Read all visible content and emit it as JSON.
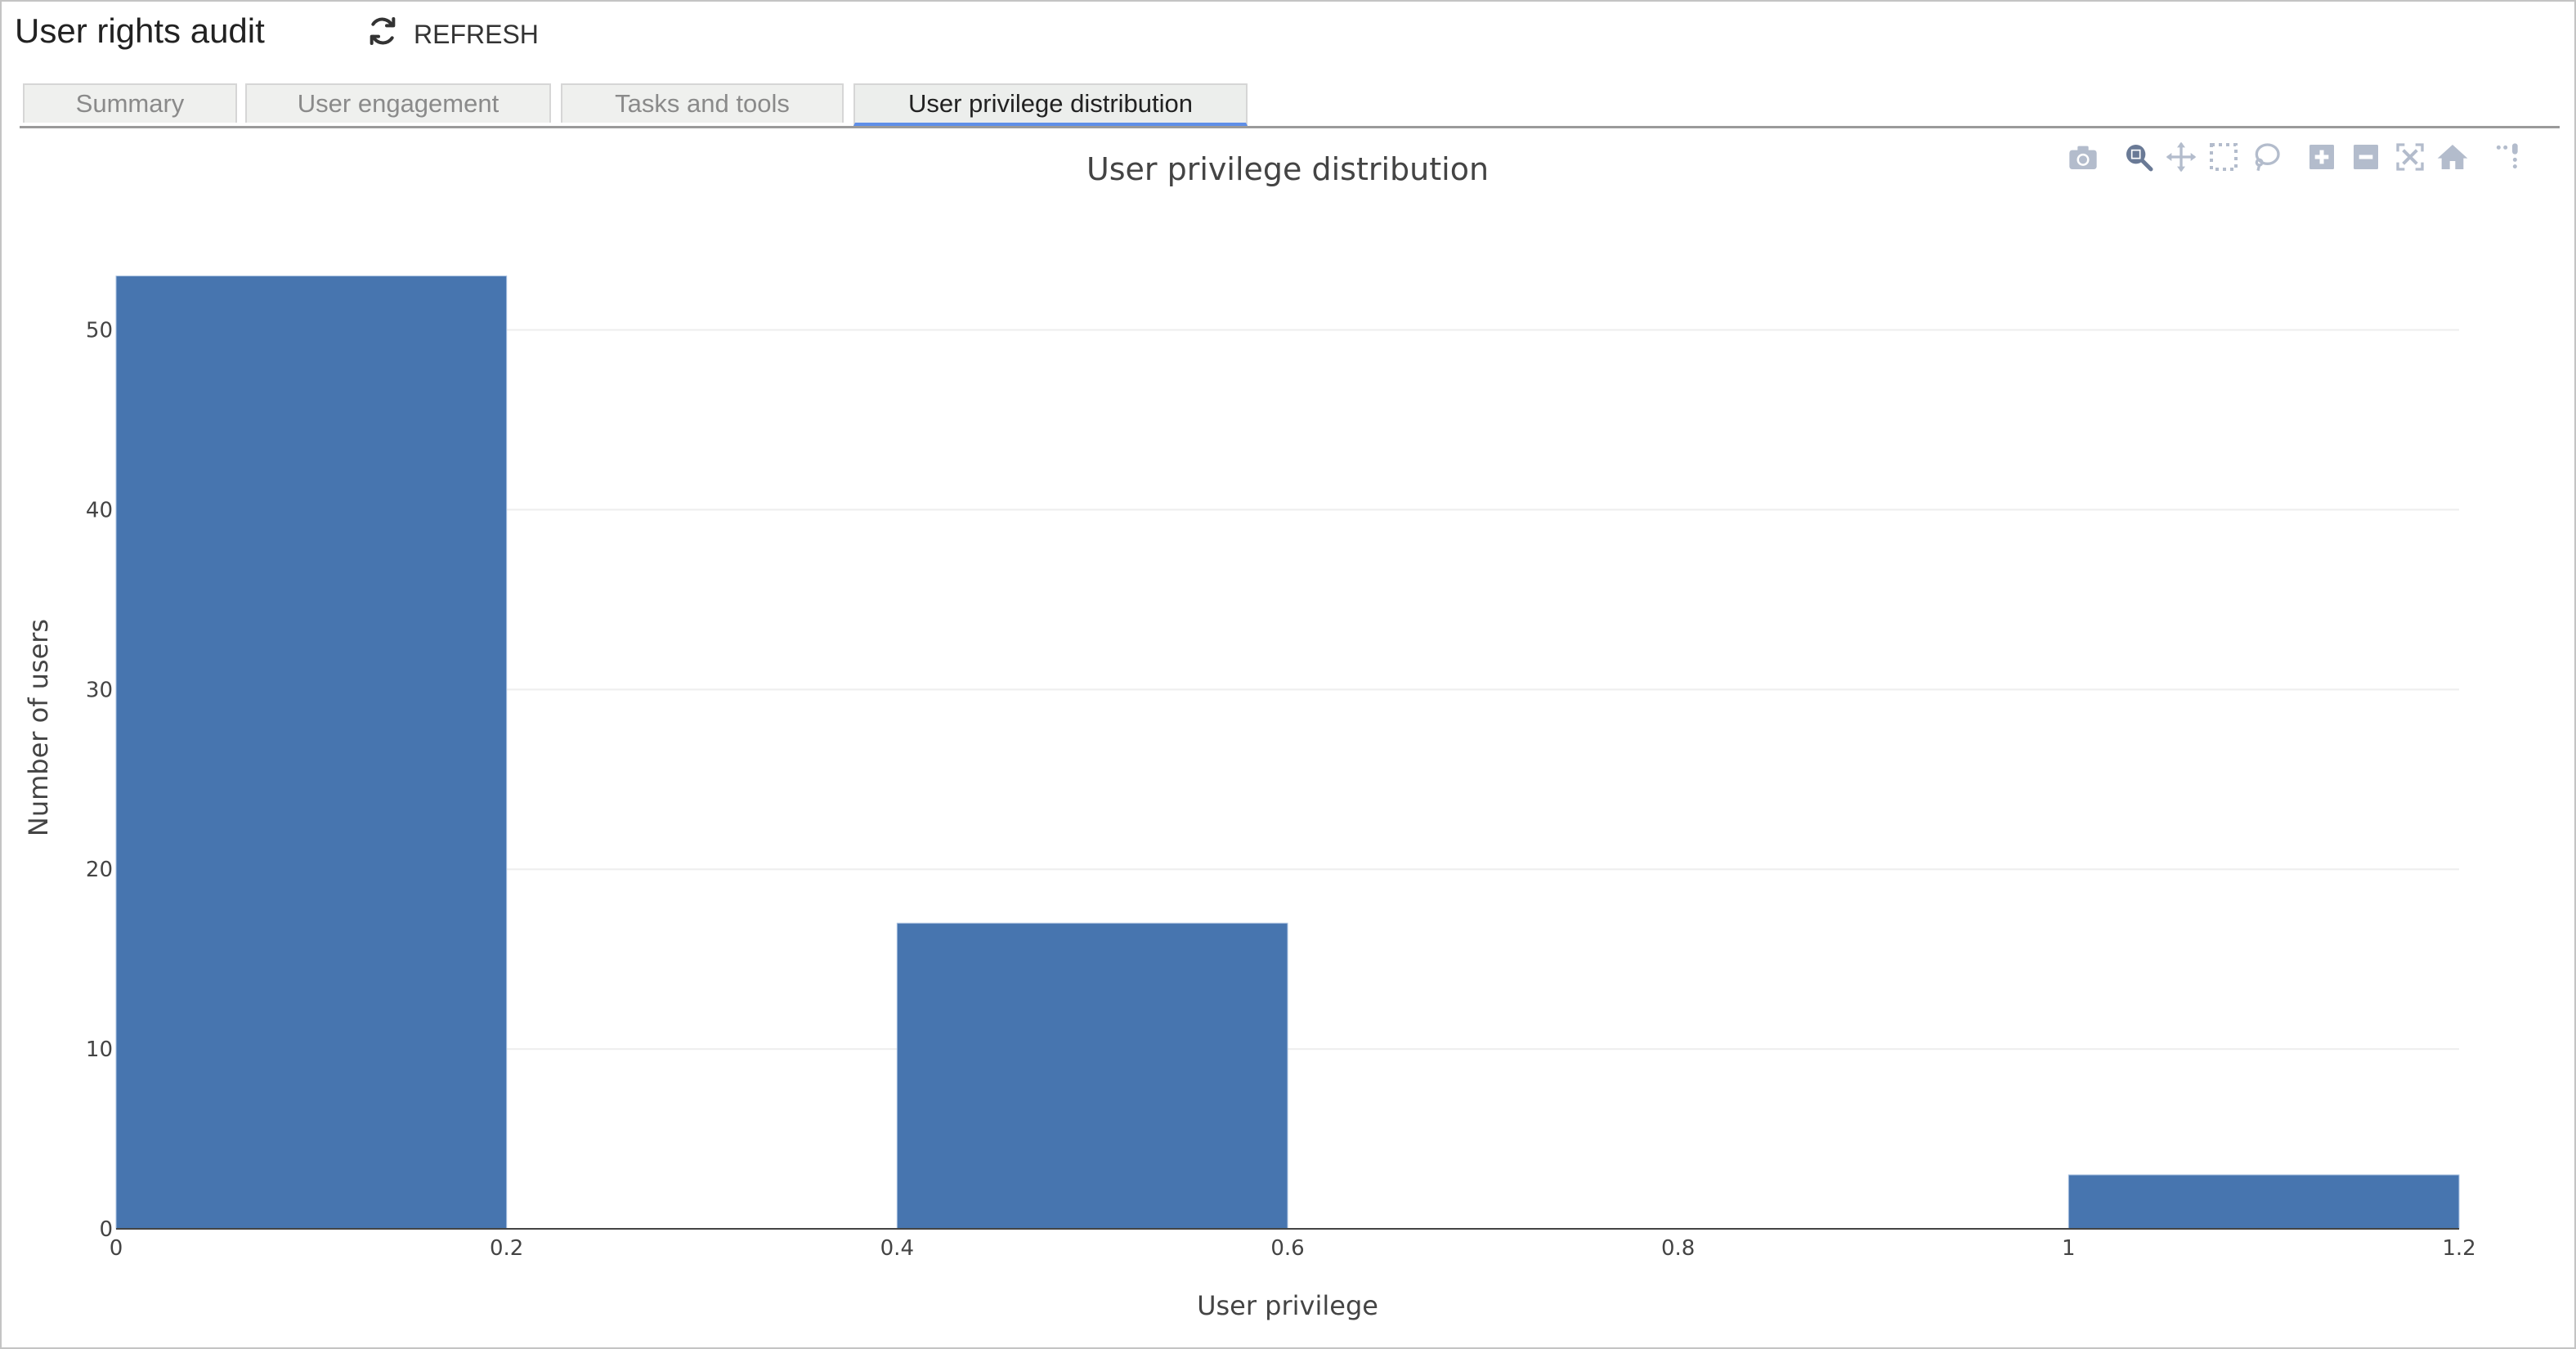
{
  "app": {
    "title": "User rights audit",
    "refresh_label": "REFRESH"
  },
  "tabs": [
    {
      "label": "Summary",
      "active": false
    },
    {
      "label": "User engagement",
      "active": false
    },
    {
      "label": "Tasks and tools",
      "active": false
    },
    {
      "label": "User privilege distribution",
      "active": true
    }
  ],
  "modebar": [
    {
      "icon": "camera-icon",
      "tooltip": "Download plot as a png"
    },
    {
      "icon": "zoom-icon",
      "tooltip": "Zoom",
      "active": true
    },
    {
      "icon": "pan-icon",
      "tooltip": "Pan"
    },
    {
      "icon": "box-select-icon",
      "tooltip": "Box Select"
    },
    {
      "icon": "lasso-select-icon",
      "tooltip": "Lasso Select"
    },
    {
      "icon": "zoom-in-icon",
      "tooltip": "Zoom in"
    },
    {
      "icon": "zoom-out-icon",
      "tooltip": "Zoom out"
    },
    {
      "icon": "autoscale-icon",
      "tooltip": "Autoscale"
    },
    {
      "icon": "reset-axes-icon",
      "tooltip": "Reset axes"
    },
    {
      "icon": "spike-lines-icon",
      "tooltip": "Toggle Spike Lines"
    }
  ],
  "colors": {
    "bar": "#4775af",
    "grid": "#eeeeee",
    "axis_line": "#444444",
    "modebar_icon": "#b3bccc",
    "modebar_icon_active": "#6a7a96",
    "tab_active_underline": "#5f8fe8"
  },
  "chart_data": {
    "type": "bar",
    "subtype": "histogram",
    "title": "User privilege distribution",
    "xlabel": "User privilege",
    "ylabel": "Number of users",
    "bins": [
      {
        "x0": 0.0,
        "x1": 0.2,
        "count": 53
      },
      {
        "x0": 0.2,
        "x1": 0.4,
        "count": 0
      },
      {
        "x0": 0.4,
        "x1": 0.6,
        "count": 17
      },
      {
        "x0": 0.6,
        "x1": 0.8,
        "count": 0
      },
      {
        "x0": 0.8,
        "x1": 1.0,
        "count": 0
      },
      {
        "x0": 1.0,
        "x1": 1.2,
        "count": 3
      }
    ],
    "xlim": [
      0,
      1.2
    ],
    "ylim": [
      0,
      55.8
    ],
    "xticks": [
      0,
      0.2,
      0.4,
      0.6,
      0.8,
      1,
      1.2
    ],
    "xtick_labels": [
      "0",
      "0.2",
      "0.4",
      "0.6",
      "0.8",
      "1",
      "1.2"
    ],
    "yticks": [
      0,
      10,
      20,
      30,
      40,
      50
    ],
    "ytick_labels": [
      "0",
      "10",
      "20",
      "30",
      "40",
      "50"
    ],
    "grid": "y-only",
    "legend": "none"
  }
}
